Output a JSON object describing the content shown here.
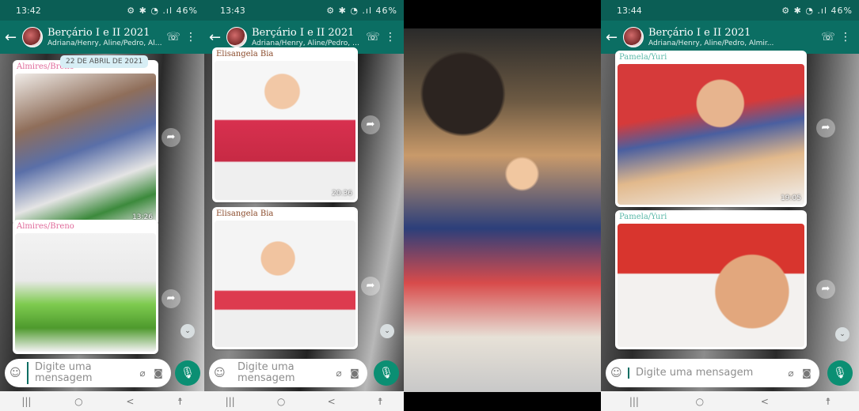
{
  "screens": [
    {
      "status_time": "13:42",
      "status_right": "⚙ ✱ ◔ .ıl 46%",
      "chat_title": "Berçário I e II 2021",
      "chat_subtitle": "Adriana/Henry, Aline/Pedro, Almir...",
      "date_chip": "22 DE ABRIL DE 2021",
      "messages": [
        {
          "sender": "Almires/Breno",
          "time": "13:26"
        },
        {
          "sender": "Almires/Breno",
          "time": ""
        }
      ],
      "composer_placeholder": "Digite uma mensagem"
    },
    {
      "status_time": "13:43",
      "status_right": "⚙ ✱ ◔ .ıl 46%",
      "chat_title": "Berçário I e II 2021",
      "chat_subtitle": "Adriana/Henry, Aline/Pedro, Almir...",
      "messages": [
        {
          "sender": "Elisangela Bia",
          "time": "20:36"
        },
        {
          "sender": "Elisangela Bia",
          "time": ""
        }
      ],
      "composer_placeholder": "Digite uma mensagem"
    },
    {
      "status_time": "13:44",
      "status_right": "⚙ ✱ ◔ .ıl 46%",
      "chat_title": "Berçário I e II 2021",
      "chat_subtitle": "Adriana/Henry, Aline/Pedro, Almir...",
      "messages": [
        {
          "sender": "Pamela/Yuri",
          "time": "19:05"
        },
        {
          "sender": "Pamela/Yuri",
          "time": ""
        }
      ],
      "composer_placeholder": "Digite uma mensagem"
    }
  ],
  "icons": {
    "back": "←",
    "add_call": "☏",
    "menu": "⋮",
    "forward": "➦",
    "scroll_down": "⌄",
    "emoji": "☺",
    "attach": "⌀",
    "camera": "◙",
    "mic": "🎙",
    "nav_recent": "|||",
    "nav_home": "○",
    "nav_back": "<",
    "nav_accessibility": "☨"
  },
  "colors": {
    "header": "#0b6e63",
    "status": "#0b5e55",
    "mic": "#0b8f73",
    "sender_pink": "#e06a9a",
    "sender_brown": "#8a4a2a",
    "sender_teal": "#5ab8a8"
  }
}
